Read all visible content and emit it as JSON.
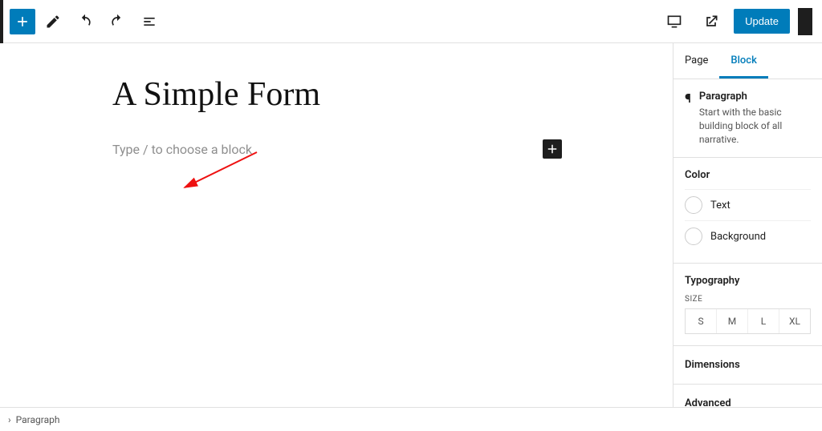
{
  "topbar": {
    "update_label": "Update"
  },
  "editor": {
    "title": "A Simple Form",
    "block_placeholder": "Type / to choose a block"
  },
  "sidebar": {
    "tabs": {
      "page": "Page",
      "block": "Block"
    },
    "block_info": {
      "name": "Paragraph",
      "description": "Start with the basic building block of all narrative."
    },
    "color": {
      "heading": "Color",
      "text_label": "Text",
      "background_label": "Background"
    },
    "typography": {
      "heading": "Typography",
      "size_label": "SIZE",
      "sizes": [
        "S",
        "M",
        "L",
        "XL"
      ]
    },
    "dimensions": {
      "heading": "Dimensions"
    },
    "advanced": {
      "heading": "Advanced"
    }
  },
  "breadcrumb": {
    "item": "Paragraph"
  }
}
